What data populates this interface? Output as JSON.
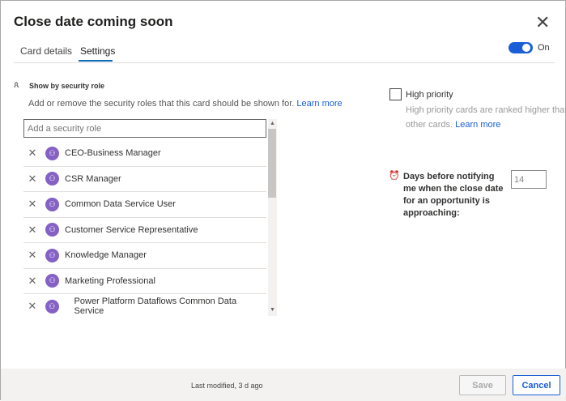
{
  "dialog": {
    "title": "Close date coming soon",
    "close_icon": "close-icon"
  },
  "tabs": [
    {
      "label": "Card details"
    },
    {
      "label": "Settings",
      "active": true
    }
  ],
  "toggle": {
    "label": "On",
    "state": true,
    "color": "#1a5fd6"
  },
  "security": {
    "heading": "Show by security role",
    "description": "Add or remove the security roles that this card should be shown for.",
    "learn_more": "Learn more",
    "placeholder": "Add a security role",
    "roles": [
      "CEO-Business Manager",
      "CSR Manager",
      "Common Data Service User",
      "Customer Service Representative",
      "Knowledge Manager",
      "Marketing Professional",
      "Power Platform Dataflows Common Data Service"
    ]
  },
  "priority": {
    "label": "High priority",
    "checked": false,
    "description": "High priority cards are ranked higher than other cards.",
    "learn_more": "Learn more"
  },
  "days": {
    "label": "Days before notifying me when the close date for an opportunity is approaching:",
    "value": "14"
  },
  "footer": {
    "last_modified": "Last modified, 3 d ago",
    "save": "Save",
    "cancel": "Cancel"
  }
}
